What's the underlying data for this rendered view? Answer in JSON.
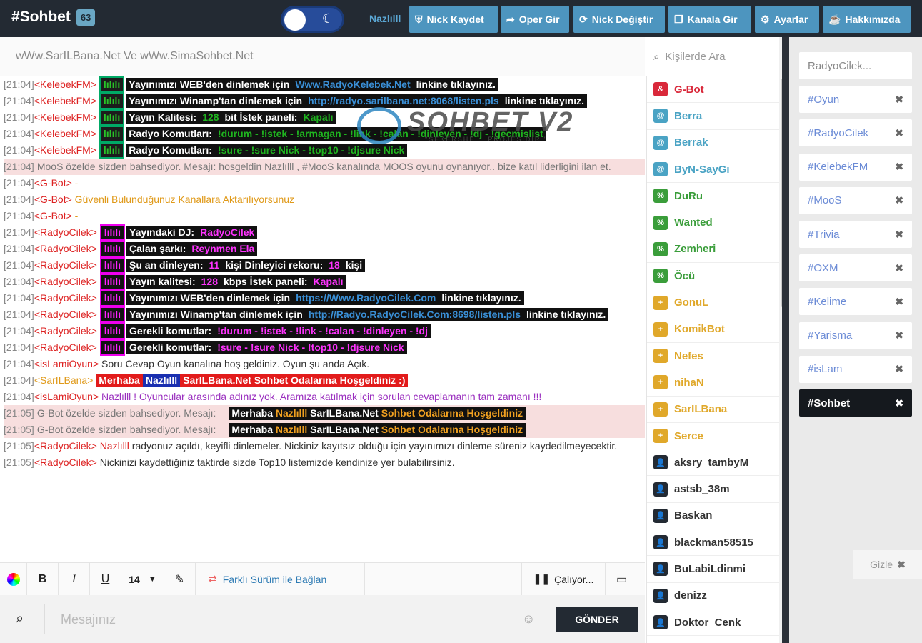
{
  "header": {
    "title": "#Sohbet",
    "count": "63",
    "nick": "Nazlılll",
    "buttons": [
      {
        "icon": "shield-icon",
        "glyph": "⛨",
        "label": "Nick Kaydet"
      },
      {
        "icon": "share-icon",
        "glyph": "➦",
        "label": "Oper Gir"
      },
      {
        "icon": "refresh-icon",
        "glyph": "⟳",
        "label": "Nick Değiştir"
      },
      {
        "icon": "copy-icon",
        "glyph": "❐",
        "label": "Kanala Gir"
      },
      {
        "icon": "gear-icon",
        "glyph": "⚙",
        "label": "Ayarlar"
      },
      {
        "icon": "coffee-icon",
        "glyph": "☕",
        "label": "Hakkımızda"
      }
    ]
  },
  "topic": "wWw.SarILBana.Net Ve wWw.SimaSohbet.Net",
  "people_search": {
    "placeholder": "Kişilerde Ara"
  },
  "watermark": {
    "title": "SOHBET V2",
    "subtitle": "\"SEKERSHELL PROJESİDİR.\""
  },
  "messages": [
    {
      "ts": "[21:04]",
      "nick": "KelebekFM",
      "style": "grn",
      "parts": [
        [
          "lılılı",
          ""
        ],
        [
          "Yayınımızı WEB'den dinlemek için ",
          ""
        ],
        [
          "Www.RadyoKelebek.Net",
          "link"
        ],
        [
          " linkine tıklayınız.",
          ""
        ]
      ]
    },
    {
      "ts": "[21:04]",
      "nick": "KelebekFM",
      "style": "grn",
      "wrap": true,
      "parts": [
        [
          "lılılı",
          ""
        ],
        [
          "Yayınımızı Winamp'tan dinlemek için ",
          ""
        ],
        [
          "http://radyo.sarilbana.net:8068/listen.pls",
          "link"
        ],
        [
          " linkine tıklayınız.",
          ""
        ]
      ]
    },
    {
      "ts": "[21:04]",
      "nick": "KelebekFM",
      "style": "grn",
      "parts": [
        [
          "lılılı",
          ""
        ],
        [
          "Yayın Kalitesi: ",
          ""
        ],
        [
          "128",
          "hl"
        ],
        [
          " bit  İstek paneli: ",
          ""
        ],
        [
          "Kapalı",
          "hl"
        ]
      ]
    },
    {
      "ts": "[21:04]",
      "nick": "KelebekFM",
      "style": "grn",
      "parts": [
        [
          "lılılı",
          ""
        ],
        [
          "Radyo Komutları: ",
          ""
        ],
        [
          "!durum - !istek - !armagan - !link - !calan - !dinleyen - !dj - !gecmislist",
          "hl"
        ]
      ]
    },
    {
      "ts": "[21:04]",
      "nick": "KelebekFM",
      "style": "grn",
      "parts": [
        [
          "lılılı",
          ""
        ],
        [
          "Radyo Komutları: ",
          ""
        ],
        [
          "!sure - !sure Nick - !top10 - !djsure Nick",
          "hl"
        ]
      ]
    },
    {
      "ts": "[21:04]",
      "private": true,
      "text": "MooS özelde sizden bahsediyor. Mesajı: hosgeldin Nazlılll , #MooS kanalında MOOS oyunu oynanıyor.. bize katıl liderligini ilan et."
    },
    {
      "ts": "[21:04]",
      "nick": "G-Bot",
      "plain": " -",
      "plainClass": "txt-orange"
    },
    {
      "ts": "[21:04]",
      "nick": "G-Bot",
      "plain": " Güvenli Bulunduğunuz Kanallara Aktarılıyorsunuz",
      "plainClass": "txt-orange"
    },
    {
      "ts": "[21:04]",
      "nick": "G-Bot",
      "plain": " -",
      "plainClass": "txt-orange"
    },
    {
      "ts": "[21:04]",
      "nick": "RadyoCilek",
      "style": "mag",
      "parts": [
        [
          "lılılı",
          ""
        ],
        [
          "Yayındaki DJ: ",
          ""
        ],
        [
          "RadyoCilek",
          "hl"
        ]
      ]
    },
    {
      "ts": "[21:04]",
      "nick": "RadyoCilek",
      "style": "mag",
      "parts": [
        [
          "lılılı",
          ""
        ],
        [
          "Çalan şarkı: ",
          ""
        ],
        [
          "Reynmen Ela",
          "hl"
        ]
      ]
    },
    {
      "ts": "[21:04]",
      "nick": "RadyoCilek",
      "style": "mag",
      "parts": [
        [
          "lılılı",
          ""
        ],
        [
          "Şu an dinleyen: ",
          ""
        ],
        [
          "11",
          "hl"
        ],
        [
          " kişi  Dinleyici rekoru: ",
          ""
        ],
        [
          "18",
          "hl"
        ],
        [
          " kişi",
          ""
        ]
      ]
    },
    {
      "ts": "[21:04]",
      "nick": "RadyoCilek",
      "style": "mag",
      "parts": [
        [
          "lılılı",
          ""
        ],
        [
          "Yayın kalitesi: ",
          ""
        ],
        [
          "128",
          "hl"
        ],
        [
          " kbps  İstek paneli: ",
          ""
        ],
        [
          "Kapalı",
          "hl"
        ]
      ]
    },
    {
      "ts": "[21:04]",
      "nick": "RadyoCilek",
      "style": "mag",
      "parts": [
        [
          "lılılı",
          ""
        ],
        [
          "Yayınımızı WEB'den dinlemek için ",
          ""
        ],
        [
          "https://Www.RadyoCilek.Com",
          "link"
        ],
        [
          " linkine tıklayınız.",
          ""
        ]
      ]
    },
    {
      "ts": "[21:04]",
      "nick": "RadyoCilek",
      "style": "mag",
      "wrap": true,
      "parts": [
        [
          "lılılı",
          ""
        ],
        [
          "Yayınımızı Winamp'tan dinlemek için ",
          ""
        ],
        [
          "http://Radyo.RadyoCilek.Com:8698/listen.pls",
          "link"
        ],
        [
          " linkine tıklayınız.",
          ""
        ]
      ]
    },
    {
      "ts": "[21:04]",
      "nick": "RadyoCilek",
      "style": "mag",
      "parts": [
        [
          "lılılı",
          ""
        ],
        [
          "Gerekli komutlar: ",
          ""
        ],
        [
          "!durum - !istek - !link - !calan - !dinleyen - !dj",
          "hl"
        ]
      ]
    },
    {
      "ts": "[21:04]",
      "nick": "RadyoCilek",
      "style": "mag",
      "parts": [
        [
          "lılılı",
          ""
        ],
        [
          "Gerekli komutlar: ",
          ""
        ],
        [
          "!sure - !sure Nick - !top10 - !djsure Nick",
          "hl"
        ]
      ]
    },
    {
      "ts": "[21:04]",
      "nick": "isLamiOyun",
      "plain": " Soru Cevap Oyun kanalına hoş geldiniz. Oyun şu anda Açık.",
      "plainClass": ""
    },
    {
      "ts": "[21:04]",
      "nick": "SarILBana",
      "nickColor": "#e09a1a",
      "sarilbana": true,
      "parts": [
        [
          "Merhaba ",
          "red"
        ],
        [
          "Nazlılll",
          "blue"
        ],
        [
          " SarILBana.Net Sohbet Odalarına Hoşgeldiniz :)",
          "red"
        ]
      ]
    },
    {
      "ts": "[21:04]",
      "nick": "isLamiOyun",
      "wrap": true,
      "plain": " Nazlılll ! Oyuncular arasında adınız yok. Aramıza katılmak için sorulan cevaplamanın tam zamanı !!!",
      "plainClass": "txt-purple"
    },
    {
      "ts": "[21:05]",
      "private": true,
      "gbot": true,
      "text": "G-Bot özelde sizden bahsediyor. Mesajı:",
      "tail": [
        [
          "Merhaba ",
          ""
        ],
        [
          "Nazlılll",
          "o"
        ],
        [
          " SarILBana.Net ",
          ""
        ],
        [
          "Sohbet Odalarına Hoşgeldiniz",
          "o"
        ]
      ]
    },
    {
      "ts": "[21:05]",
      "private": true,
      "gbot": true,
      "text": "G-Bot özelde sizden bahsediyor. Mesajı:",
      "tail": [
        [
          "Merhaba ",
          ""
        ],
        [
          "Nazlılll",
          "o"
        ],
        [
          " SarILBana.Net ",
          ""
        ],
        [
          "Sohbet Odalarına Hoşgeldiniz",
          "o"
        ]
      ]
    },
    {
      "ts": "[21:05]",
      "nick": "RadyoCilek",
      "wrap": true,
      "plainHtml": [
        [
          " Nazlılll",
          "red"
        ],
        [
          " radyonuz açıldı, keyifli dinlemeler. Nickiniz kayıtsız olduğu için yayınımızı dinleme süreniz kaydedilmeyecektir.",
          ""
        ]
      ]
    },
    {
      "ts": "[21:05]",
      "nick": "RadyoCilek",
      "plain": " Nickinizi kaydettiğiniz taktirde sizde Top10 listemizde kendinize yer bulabilirsiniz.",
      "plainClass": ""
    }
  ],
  "toolbar": {
    "font_size": "14",
    "alt_connect": "Farklı Sürüm ile Bağlan",
    "player": "Çalıyor..."
  },
  "composer": {
    "placeholder": "Mesajınız",
    "send": "GÖNDER"
  },
  "users": [
    {
      "name": "G-Bot",
      "color": "#d9283a",
      "icon": "&"
    },
    {
      "name": "Berra",
      "color": "#4aa3c4",
      "icon": "@"
    },
    {
      "name": "Berrak",
      "color": "#4aa3c4",
      "icon": "@"
    },
    {
      "name": "ByN-SayGı",
      "color": "#4aa3c4",
      "icon": "@"
    },
    {
      "name": "DuRu",
      "color": "#3a9d3a",
      "icon": "%"
    },
    {
      "name": "Wanted",
      "color": "#3a9d3a",
      "icon": "%"
    },
    {
      "name": "Zemheri",
      "color": "#3a9d3a",
      "icon": "%"
    },
    {
      "name": "Öcü",
      "color": "#3a9d3a",
      "icon": "%"
    },
    {
      "name": "GonuL",
      "color": "#e0a82a",
      "icon": "+"
    },
    {
      "name": "KomikBot",
      "color": "#e0a82a",
      "icon": "+"
    },
    {
      "name": "Nefes",
      "color": "#e0a82a",
      "icon": "+"
    },
    {
      "name": "nihaN",
      "color": "#e0a82a",
      "icon": "+"
    },
    {
      "name": "SarILBana",
      "color": "#e0a82a",
      "icon": "+"
    },
    {
      "name": "Serce",
      "color": "#e0a82a",
      "icon": "+"
    },
    {
      "name": "aksry_tambyM",
      "color": "#232a33",
      "icon": "👤"
    },
    {
      "name": "astsb_38m",
      "color": "#232a33",
      "icon": "👤"
    },
    {
      "name": "Baskan",
      "color": "#232a33",
      "icon": "👤"
    },
    {
      "name": "blackman58515",
      "color": "#232a33",
      "icon": "👤"
    },
    {
      "name": "BuLabiLdinmi",
      "color": "#232a33",
      "icon": "👤"
    },
    {
      "name": "denizz",
      "color": "#232a33",
      "icon": "👤"
    },
    {
      "name": "Doktor_Cenk",
      "color": "#232a33",
      "icon": "👤"
    }
  ],
  "channels": [
    {
      "name": "RadyoCilek...",
      "closable": false
    },
    {
      "name": "#Oyun",
      "closable": true
    },
    {
      "name": "#RadyoCilek",
      "closable": true
    },
    {
      "name": "#KelebekFM",
      "closable": true
    },
    {
      "name": "#MooS",
      "closable": true
    },
    {
      "name": "#Trivia",
      "closable": true
    },
    {
      "name": "#OXM",
      "closable": true
    },
    {
      "name": "#Kelime",
      "closable": true
    },
    {
      "name": "#Yarisma",
      "closable": true
    },
    {
      "name": "#isLam",
      "closable": true
    },
    {
      "name": "#Sohbet",
      "closable": true,
      "active": true
    }
  ],
  "hide_label": "Gizle"
}
